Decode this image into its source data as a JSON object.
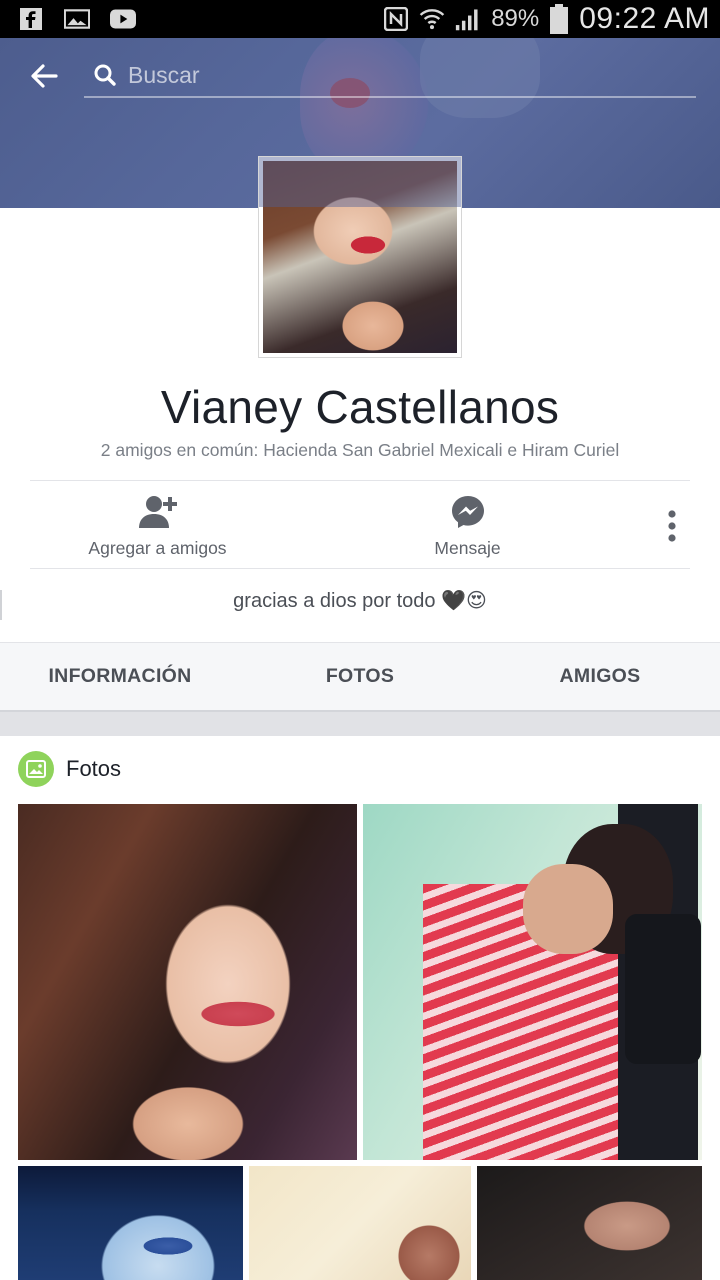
{
  "status_bar": {
    "battery": "89%",
    "time": "09:22 AM",
    "left_icons": [
      "facebook-icon",
      "gallery-icon",
      "youtube-icon"
    ],
    "right_icons": [
      "nfc-icon",
      "wifi-icon",
      "signal-icon",
      "battery-icon"
    ]
  },
  "header": {
    "search_placeholder": "Buscar",
    "cover_color": "#56679a"
  },
  "profile": {
    "name": "Vianey Castellanos",
    "mutual_friends": "2 amigos en común: Hacienda San Gabriel Mexicali e Hiram Curiel",
    "bio": "gracias a dios por todo 🖤😍"
  },
  "actions": {
    "add_friend": "Agregar a amigos",
    "message": "Mensaje"
  },
  "tabs": [
    {
      "label": "INFORMACIÓN"
    },
    {
      "label": "FOTOS"
    },
    {
      "label": "AMIGOS"
    }
  ],
  "photos_section": {
    "title": "Fotos",
    "icon_color": "#8fd35b"
  },
  "colors": {
    "text_primary": "#1d2129",
    "text_secondary": "#7a7f87",
    "tab_text": "#4b4f56",
    "icon_gray": "#5f636b"
  }
}
